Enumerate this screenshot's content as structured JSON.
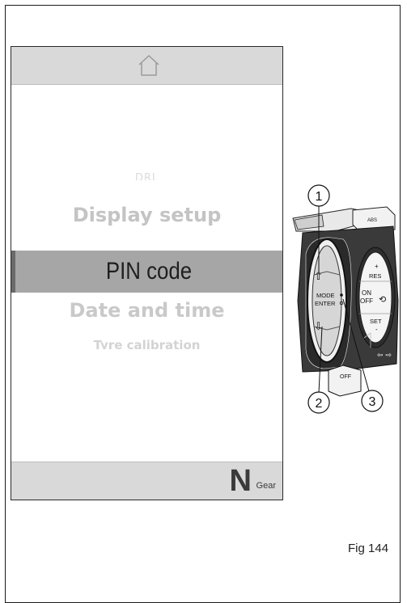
{
  "screen": {
    "menu": {
      "items": [
        "DRL",
        "Display setup",
        "PIN code",
        "Date and time",
        "Tyre calibration"
      ],
      "selected": "PIN code"
    },
    "status": {
      "gear": "N",
      "gear_label": "Gear"
    }
  },
  "callouts": [
    "1",
    "2",
    "3"
  ],
  "switch_labels": {
    "mode": "MODE",
    "enter": "ENTER",
    "res": "RES",
    "on": "ON",
    "off": "OFF",
    "set": "SET",
    "off_switch": "OFF",
    "abs": "ABS"
  },
  "figure": {
    "caption": "Fig 144"
  }
}
